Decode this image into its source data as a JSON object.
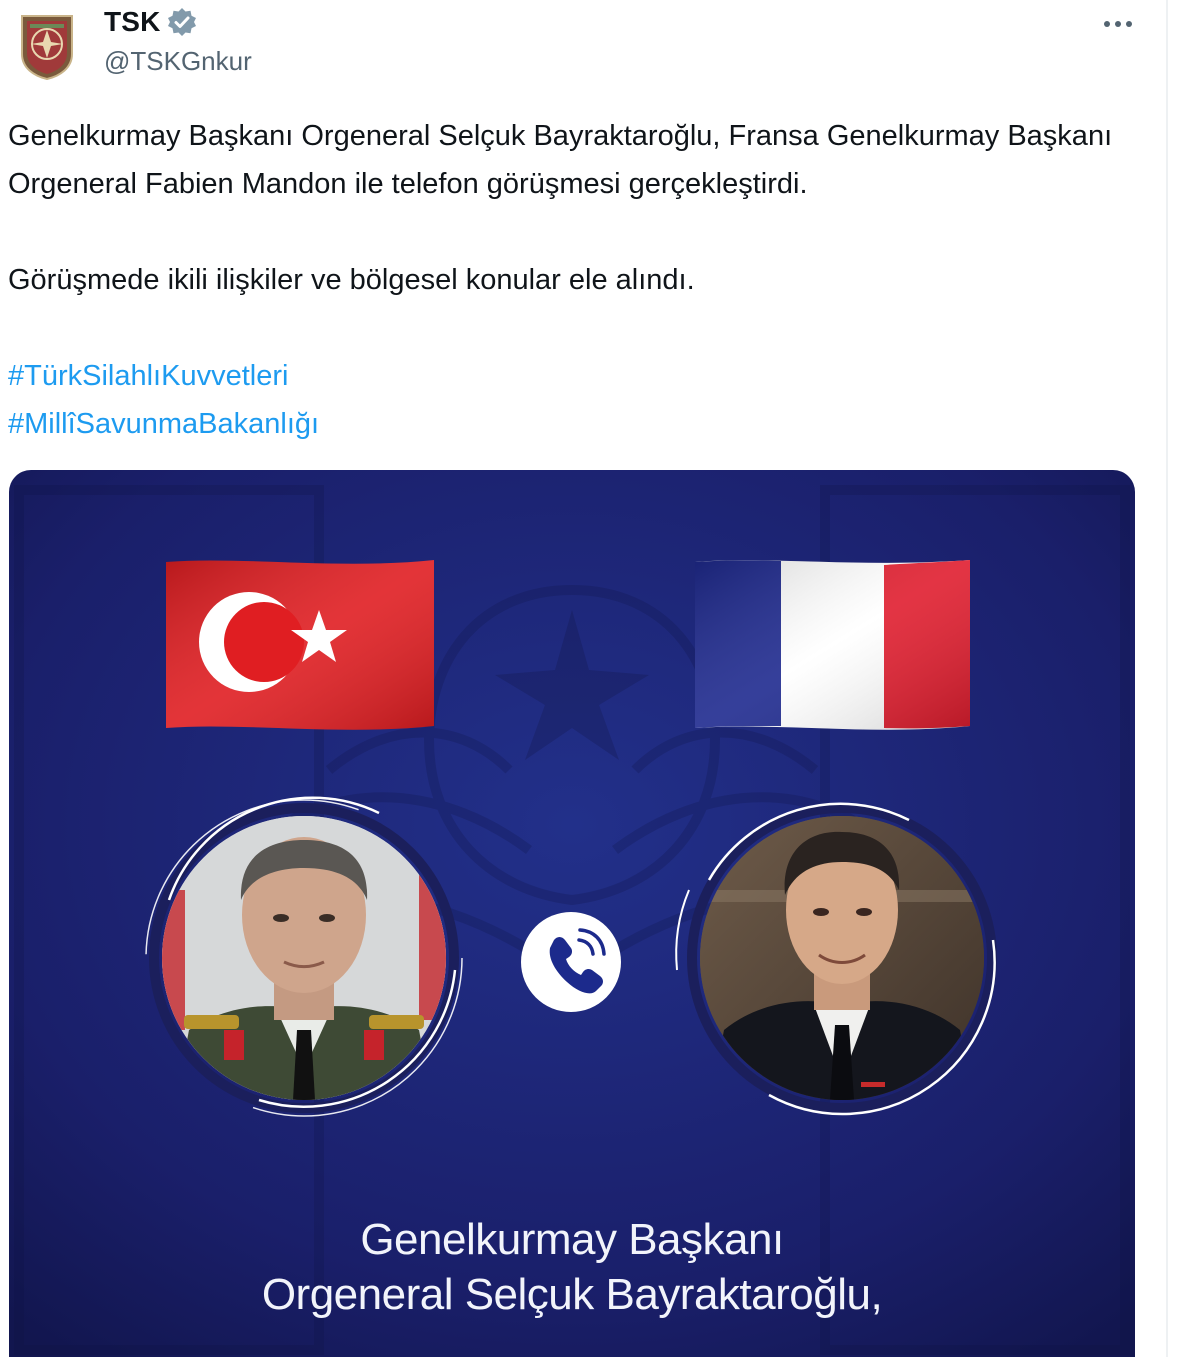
{
  "author": {
    "display_name": "TSK",
    "handle": "@TSKGnkur",
    "verified": true,
    "verified_badge_color": "#829aab"
  },
  "tweet": {
    "paragraphs": [
      "Genelkurmay Başkanı Orgeneral Selçuk Bayraktaroğlu, Fransa Genelkurmay Başkanı Orgeneral Fabien Mandon ile telefon görüşmesi gerçekleştirdi.",
      "Görüşmede ikili ilişkiler ve bölgesel konular ele alındı."
    ],
    "hashtags": [
      "#TürkSilahlıKuvvetleri",
      "#MillîSavunmaBakanlığı"
    ],
    "link_color": "#1d9bf0"
  },
  "media": {
    "background_color": "#1a1f6a",
    "flags": [
      "turkey-flag",
      "france-flag"
    ],
    "caption_line_1": "Genelkurmay Başkanı",
    "caption_line_2": "Orgeneral Selçuk Bayraktaroğlu,"
  },
  "icons": {
    "more": "more-horizontal-icon",
    "call": "phone-call-icon",
    "verified": "verified-badge-icon"
  }
}
